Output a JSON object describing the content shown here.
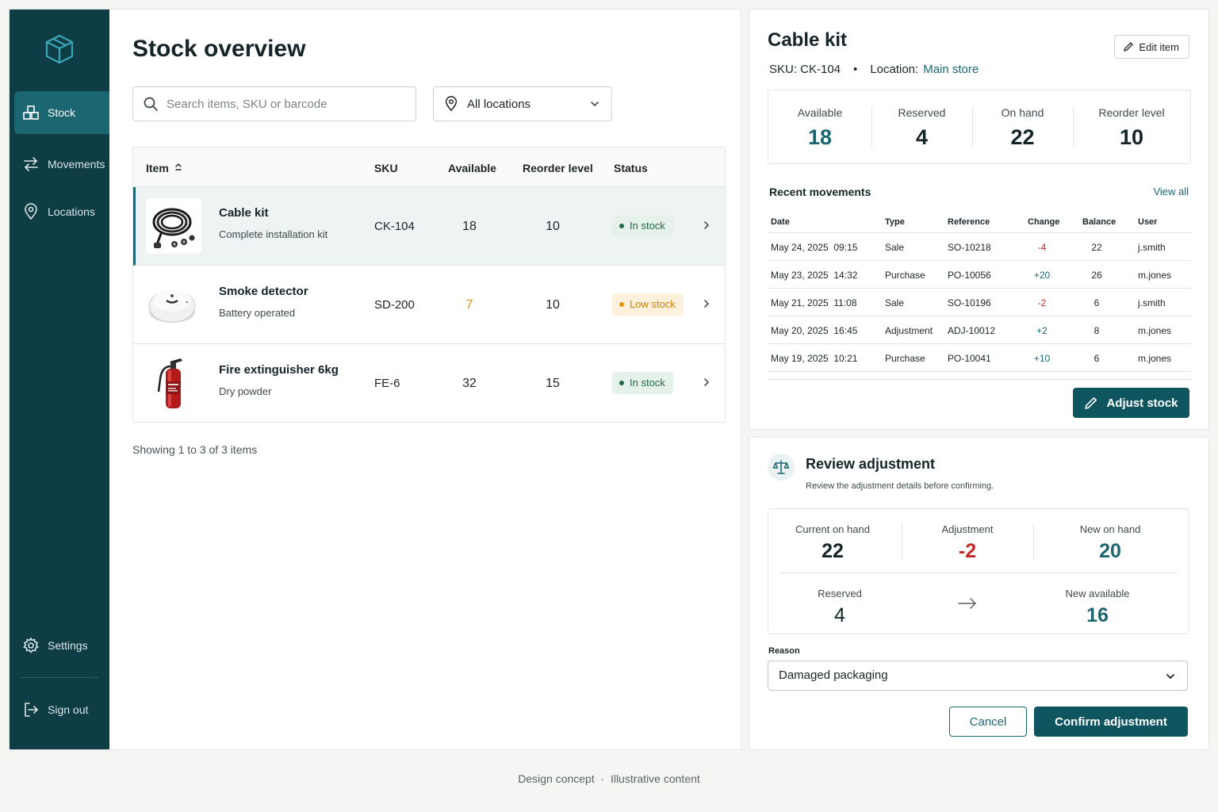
{
  "sidebar": {
    "items": [
      {
        "label": "Stock",
        "icon": "boxes-icon"
      },
      {
        "label": "Movements",
        "icon": "swap-arrows-icon"
      },
      {
        "label": "Locations",
        "icon": "map-pin-icon"
      },
      {
        "label": "Settings",
        "icon": "gear-icon"
      },
      {
        "label": "Sign out",
        "icon": "sign-out-icon"
      }
    ]
  },
  "main": {
    "title": "Stock overview",
    "search_placeholder": "Search items, SKU or barcode",
    "location_filter": "All locations",
    "columns": [
      "Item",
      "SKU",
      "Available",
      "Reorder level",
      "Status"
    ],
    "rows": [
      {
        "name": "Cable kit",
        "desc": "Complete installation kit",
        "sku": "CK-104",
        "available": "18",
        "reorder": "10",
        "status": "In stock"
      },
      {
        "name": "Smoke detector",
        "desc": "Battery operated",
        "sku": "SD-200",
        "available": "7",
        "reorder": "10",
        "status": "Low stock"
      },
      {
        "name": "Fire extinguisher 6kg",
        "desc": "Dry powder",
        "sku": "FE-6",
        "available": "32",
        "reorder": "15",
        "status": "In stock"
      }
    ],
    "showing": "Showing 1 to 3 of 3 items"
  },
  "detail": {
    "title": "Cable kit",
    "sku_text": "SKU: CK-104",
    "bullet": "•",
    "location_label": "Location:",
    "location_value": "Main store",
    "edit_label": "Edit item",
    "stats": [
      {
        "label": "Available",
        "value": "18"
      },
      {
        "label": "Reserved",
        "value": "4"
      },
      {
        "label": "On hand",
        "value": "22"
      },
      {
        "label": "Reorder level",
        "value": "10"
      }
    ],
    "movements_title": "Recent movements",
    "view_all": "View all",
    "movement_columns": [
      "Date",
      "Type",
      "Reference",
      "Change",
      "Balance",
      "User"
    ],
    "movements": [
      {
        "date": "May 24, 2025  09:15",
        "type": "Sale",
        "ref": "SO-10218",
        "change": "-4",
        "balance": "22",
        "user": "j.smith"
      },
      {
        "date": "May 23, 2025  14:32",
        "type": "Purchase",
        "ref": "PO-10056",
        "change": "+20",
        "balance": "26",
        "user": "m.jones"
      },
      {
        "date": "May 21, 2025  11:08",
        "type": "Sale",
        "ref": "SO-10196",
        "change": "-2",
        "balance": "6",
        "user": "j.smith"
      },
      {
        "date": "May 20, 2025  16:45",
        "type": "Adjustment",
        "ref": "ADJ-10012",
        "change": "+2",
        "balance": "8",
        "user": "m.jones"
      },
      {
        "date": "May 19, 2025  10:21",
        "type": "Purchase",
        "ref": "PO-10041",
        "change": "+10",
        "balance": "6",
        "user": "m.jones"
      }
    ],
    "adjust_label": "Adjust stock"
  },
  "review": {
    "title": "Review adjustment",
    "subtitle": "Review the adjustment details before confirming.",
    "current_label": "Current on hand",
    "current_value": "22",
    "adjustment_label": "Adjustment",
    "adjustment_value": "-2",
    "new_on_hand_label": "New on hand",
    "new_on_hand_value": "20",
    "reserved_label": "Reserved",
    "reserved_value": "4",
    "new_available_label": "New available",
    "new_available_value": "16",
    "reason_label": "Reason",
    "reason_value": "Damaged packaging",
    "cancel_label": "Cancel",
    "confirm_label": "Confirm adjustment"
  },
  "footer": "Design concept  ·  Illustrative content",
  "colors": {
    "brand_dark": "#0f3d46",
    "accent": "#1c6672",
    "danger": "#c62828",
    "warning": "#e5920e",
    "success": "#236b46"
  }
}
